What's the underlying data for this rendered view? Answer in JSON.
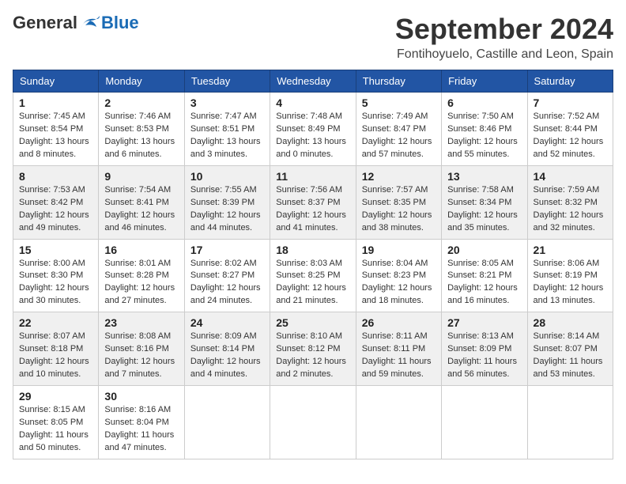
{
  "header": {
    "logo_general": "General",
    "logo_blue": "Blue",
    "month_year": "September 2024",
    "location": "Fontihoyuelo, Castille and Leon, Spain"
  },
  "weekdays": [
    "Sunday",
    "Monday",
    "Tuesday",
    "Wednesday",
    "Thursday",
    "Friday",
    "Saturday"
  ],
  "weeks": [
    [
      {
        "day": 1,
        "sunrise": "7:45 AM",
        "sunset": "8:54 PM",
        "daylight": "13 hours and 8 minutes"
      },
      {
        "day": 2,
        "sunrise": "7:46 AM",
        "sunset": "8:53 PM",
        "daylight": "13 hours and 6 minutes"
      },
      {
        "day": 3,
        "sunrise": "7:47 AM",
        "sunset": "8:51 PM",
        "daylight": "13 hours and 3 minutes"
      },
      {
        "day": 4,
        "sunrise": "7:48 AM",
        "sunset": "8:49 PM",
        "daylight": "13 hours and 0 minutes"
      },
      {
        "day": 5,
        "sunrise": "7:49 AM",
        "sunset": "8:47 PM",
        "daylight": "12 hours and 57 minutes"
      },
      {
        "day": 6,
        "sunrise": "7:50 AM",
        "sunset": "8:46 PM",
        "daylight": "12 hours and 55 minutes"
      },
      {
        "day": 7,
        "sunrise": "7:52 AM",
        "sunset": "8:44 PM",
        "daylight": "12 hours and 52 minutes"
      }
    ],
    [
      {
        "day": 8,
        "sunrise": "7:53 AM",
        "sunset": "8:42 PM",
        "daylight": "12 hours and 49 minutes"
      },
      {
        "day": 9,
        "sunrise": "7:54 AM",
        "sunset": "8:41 PM",
        "daylight": "12 hours and 46 minutes"
      },
      {
        "day": 10,
        "sunrise": "7:55 AM",
        "sunset": "8:39 PM",
        "daylight": "12 hours and 44 minutes"
      },
      {
        "day": 11,
        "sunrise": "7:56 AM",
        "sunset": "8:37 PM",
        "daylight": "12 hours and 41 minutes"
      },
      {
        "day": 12,
        "sunrise": "7:57 AM",
        "sunset": "8:35 PM",
        "daylight": "12 hours and 38 minutes"
      },
      {
        "day": 13,
        "sunrise": "7:58 AM",
        "sunset": "8:34 PM",
        "daylight": "12 hours and 35 minutes"
      },
      {
        "day": 14,
        "sunrise": "7:59 AM",
        "sunset": "8:32 PM",
        "daylight": "12 hours and 32 minutes"
      }
    ],
    [
      {
        "day": 15,
        "sunrise": "8:00 AM",
        "sunset": "8:30 PM",
        "daylight": "12 hours and 30 minutes"
      },
      {
        "day": 16,
        "sunrise": "8:01 AM",
        "sunset": "8:28 PM",
        "daylight": "12 hours and 27 minutes"
      },
      {
        "day": 17,
        "sunrise": "8:02 AM",
        "sunset": "8:27 PM",
        "daylight": "12 hours and 24 minutes"
      },
      {
        "day": 18,
        "sunrise": "8:03 AM",
        "sunset": "8:25 PM",
        "daylight": "12 hours and 21 minutes"
      },
      {
        "day": 19,
        "sunrise": "8:04 AM",
        "sunset": "8:23 PM",
        "daylight": "12 hours and 18 minutes"
      },
      {
        "day": 20,
        "sunrise": "8:05 AM",
        "sunset": "8:21 PM",
        "daylight": "12 hours and 16 minutes"
      },
      {
        "day": 21,
        "sunrise": "8:06 AM",
        "sunset": "8:19 PM",
        "daylight": "12 hours and 13 minutes"
      }
    ],
    [
      {
        "day": 22,
        "sunrise": "8:07 AM",
        "sunset": "8:18 PM",
        "daylight": "12 hours and 10 minutes"
      },
      {
        "day": 23,
        "sunrise": "8:08 AM",
        "sunset": "8:16 PM",
        "daylight": "12 hours and 7 minutes"
      },
      {
        "day": 24,
        "sunrise": "8:09 AM",
        "sunset": "8:14 PM",
        "daylight": "12 hours and 4 minutes"
      },
      {
        "day": 25,
        "sunrise": "8:10 AM",
        "sunset": "8:12 PM",
        "daylight": "12 hours and 2 minutes"
      },
      {
        "day": 26,
        "sunrise": "8:11 AM",
        "sunset": "8:11 PM",
        "daylight": "11 hours and 59 minutes"
      },
      {
        "day": 27,
        "sunrise": "8:13 AM",
        "sunset": "8:09 PM",
        "daylight": "11 hours and 56 minutes"
      },
      {
        "day": 28,
        "sunrise": "8:14 AM",
        "sunset": "8:07 PM",
        "daylight": "11 hours and 53 minutes"
      }
    ],
    [
      {
        "day": 29,
        "sunrise": "8:15 AM",
        "sunset": "8:05 PM",
        "daylight": "11 hours and 50 minutes"
      },
      {
        "day": 30,
        "sunrise": "8:16 AM",
        "sunset": "8:04 PM",
        "daylight": "11 hours and 47 minutes"
      },
      null,
      null,
      null,
      null,
      null
    ]
  ]
}
